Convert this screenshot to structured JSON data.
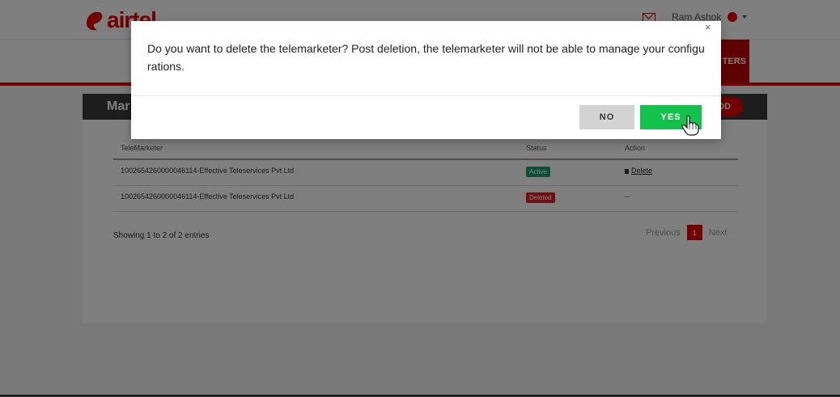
{
  "brand": {
    "logo_text": "airtel",
    "logo_color": "#e40000"
  },
  "header": {
    "user_name": "Ram Ashok"
  },
  "nav": {
    "active_item": "TERS"
  },
  "panel": {
    "title": "Mar",
    "add_label": "DD"
  },
  "table": {
    "columns": [
      "TeleMarketer",
      "Status",
      "Action"
    ],
    "rows": [
      {
        "telemarketer": "1002654260000046114-Effective Teleservices Pvt Ltd",
        "status": "Active",
        "action": "Delete"
      },
      {
        "telemarketer": "1002654260000046114-Effective Teleservices Pvt Ltd",
        "status": "Deleted",
        "action": "--"
      }
    ]
  },
  "footer": {
    "info": "Showing 1 to 2 of 2 entries"
  },
  "pagination": {
    "previous": "Previous",
    "current": "1",
    "next": "Next"
  },
  "modal": {
    "close": "×",
    "message": "Do you want to delete the telemarketer? Post deletion, the telemarketer will not be able to manage your configurations.",
    "no_label": "NO",
    "yes_label": "YES"
  },
  "colors": {
    "accent": "#e40000",
    "yes_green": "#12c24c",
    "active_badge": "#1aa06d",
    "deleted_badge": "#e0202a"
  },
  "icons": [
    "mail-icon",
    "user-icon",
    "trash-icon",
    "close-icon",
    "hand-cursor-icon"
  ]
}
